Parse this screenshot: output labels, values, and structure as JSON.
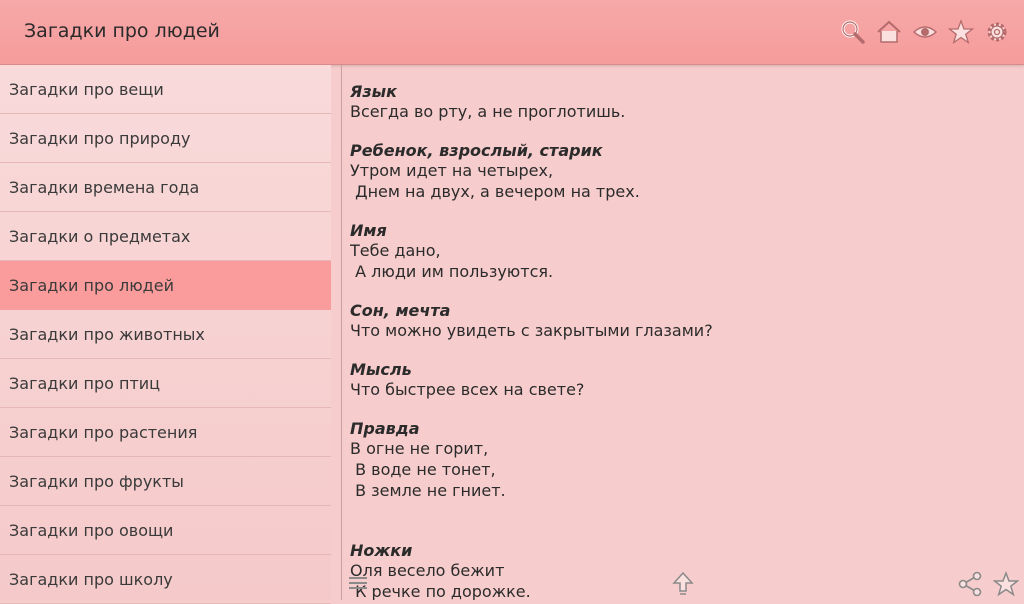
{
  "header": {
    "title": "Загадки про людей"
  },
  "toolbar": {
    "icons": [
      "search-icon",
      "home-icon",
      "eye-icon",
      "star-icon",
      "gear-icon"
    ]
  },
  "sidebar": {
    "items": [
      {
        "label": "Загадки про вещи"
      },
      {
        "label": "Загадки про природу"
      },
      {
        "label": "Загадки времена года"
      },
      {
        "label": "Загадки о предметах"
      },
      {
        "label": "Загадки про людей"
      },
      {
        "label": "Загадки про животных"
      },
      {
        "label": "Загадки про птиц"
      },
      {
        "label": "Загадки про растения"
      },
      {
        "label": "Загадки про фрукты"
      },
      {
        "label": "Загадки про овощи"
      },
      {
        "label": "Загадки про школу"
      }
    ],
    "active_index": 4
  },
  "riddles": [
    {
      "title": "Язык",
      "lines": [
        "Всегда во рту, а не проглотишь."
      ]
    },
    {
      "title": "Ребенок, взрослый, старик",
      "lines": [
        "Утром идет на четырех,",
        " Днем на двух, а вечером на трех."
      ]
    },
    {
      "title": "Имя",
      "lines": [
        "Тебе дано,",
        " А люди им пользуются."
      ]
    },
    {
      "title": "Сон, мечта",
      "lines": [
        "Что можно увидеть с закрытыми глазами?"
      ]
    },
    {
      "title": "Мысль",
      "lines": [
        "Что быстрее всех на свете?"
      ]
    },
    {
      "title": "Правда",
      "lines": [
        "В огне не горит,",
        " В воде не тонет,",
        " В земле не гниет."
      ]
    },
    {
      "title": "Ножки",
      "lines": [
        "Оля весело бежит",
        " К речке по дорожке."
      ]
    }
  ],
  "colors": {
    "header": "#f59c9c",
    "active_item": "#fb9c9c",
    "background": "#f7cccc"
  }
}
